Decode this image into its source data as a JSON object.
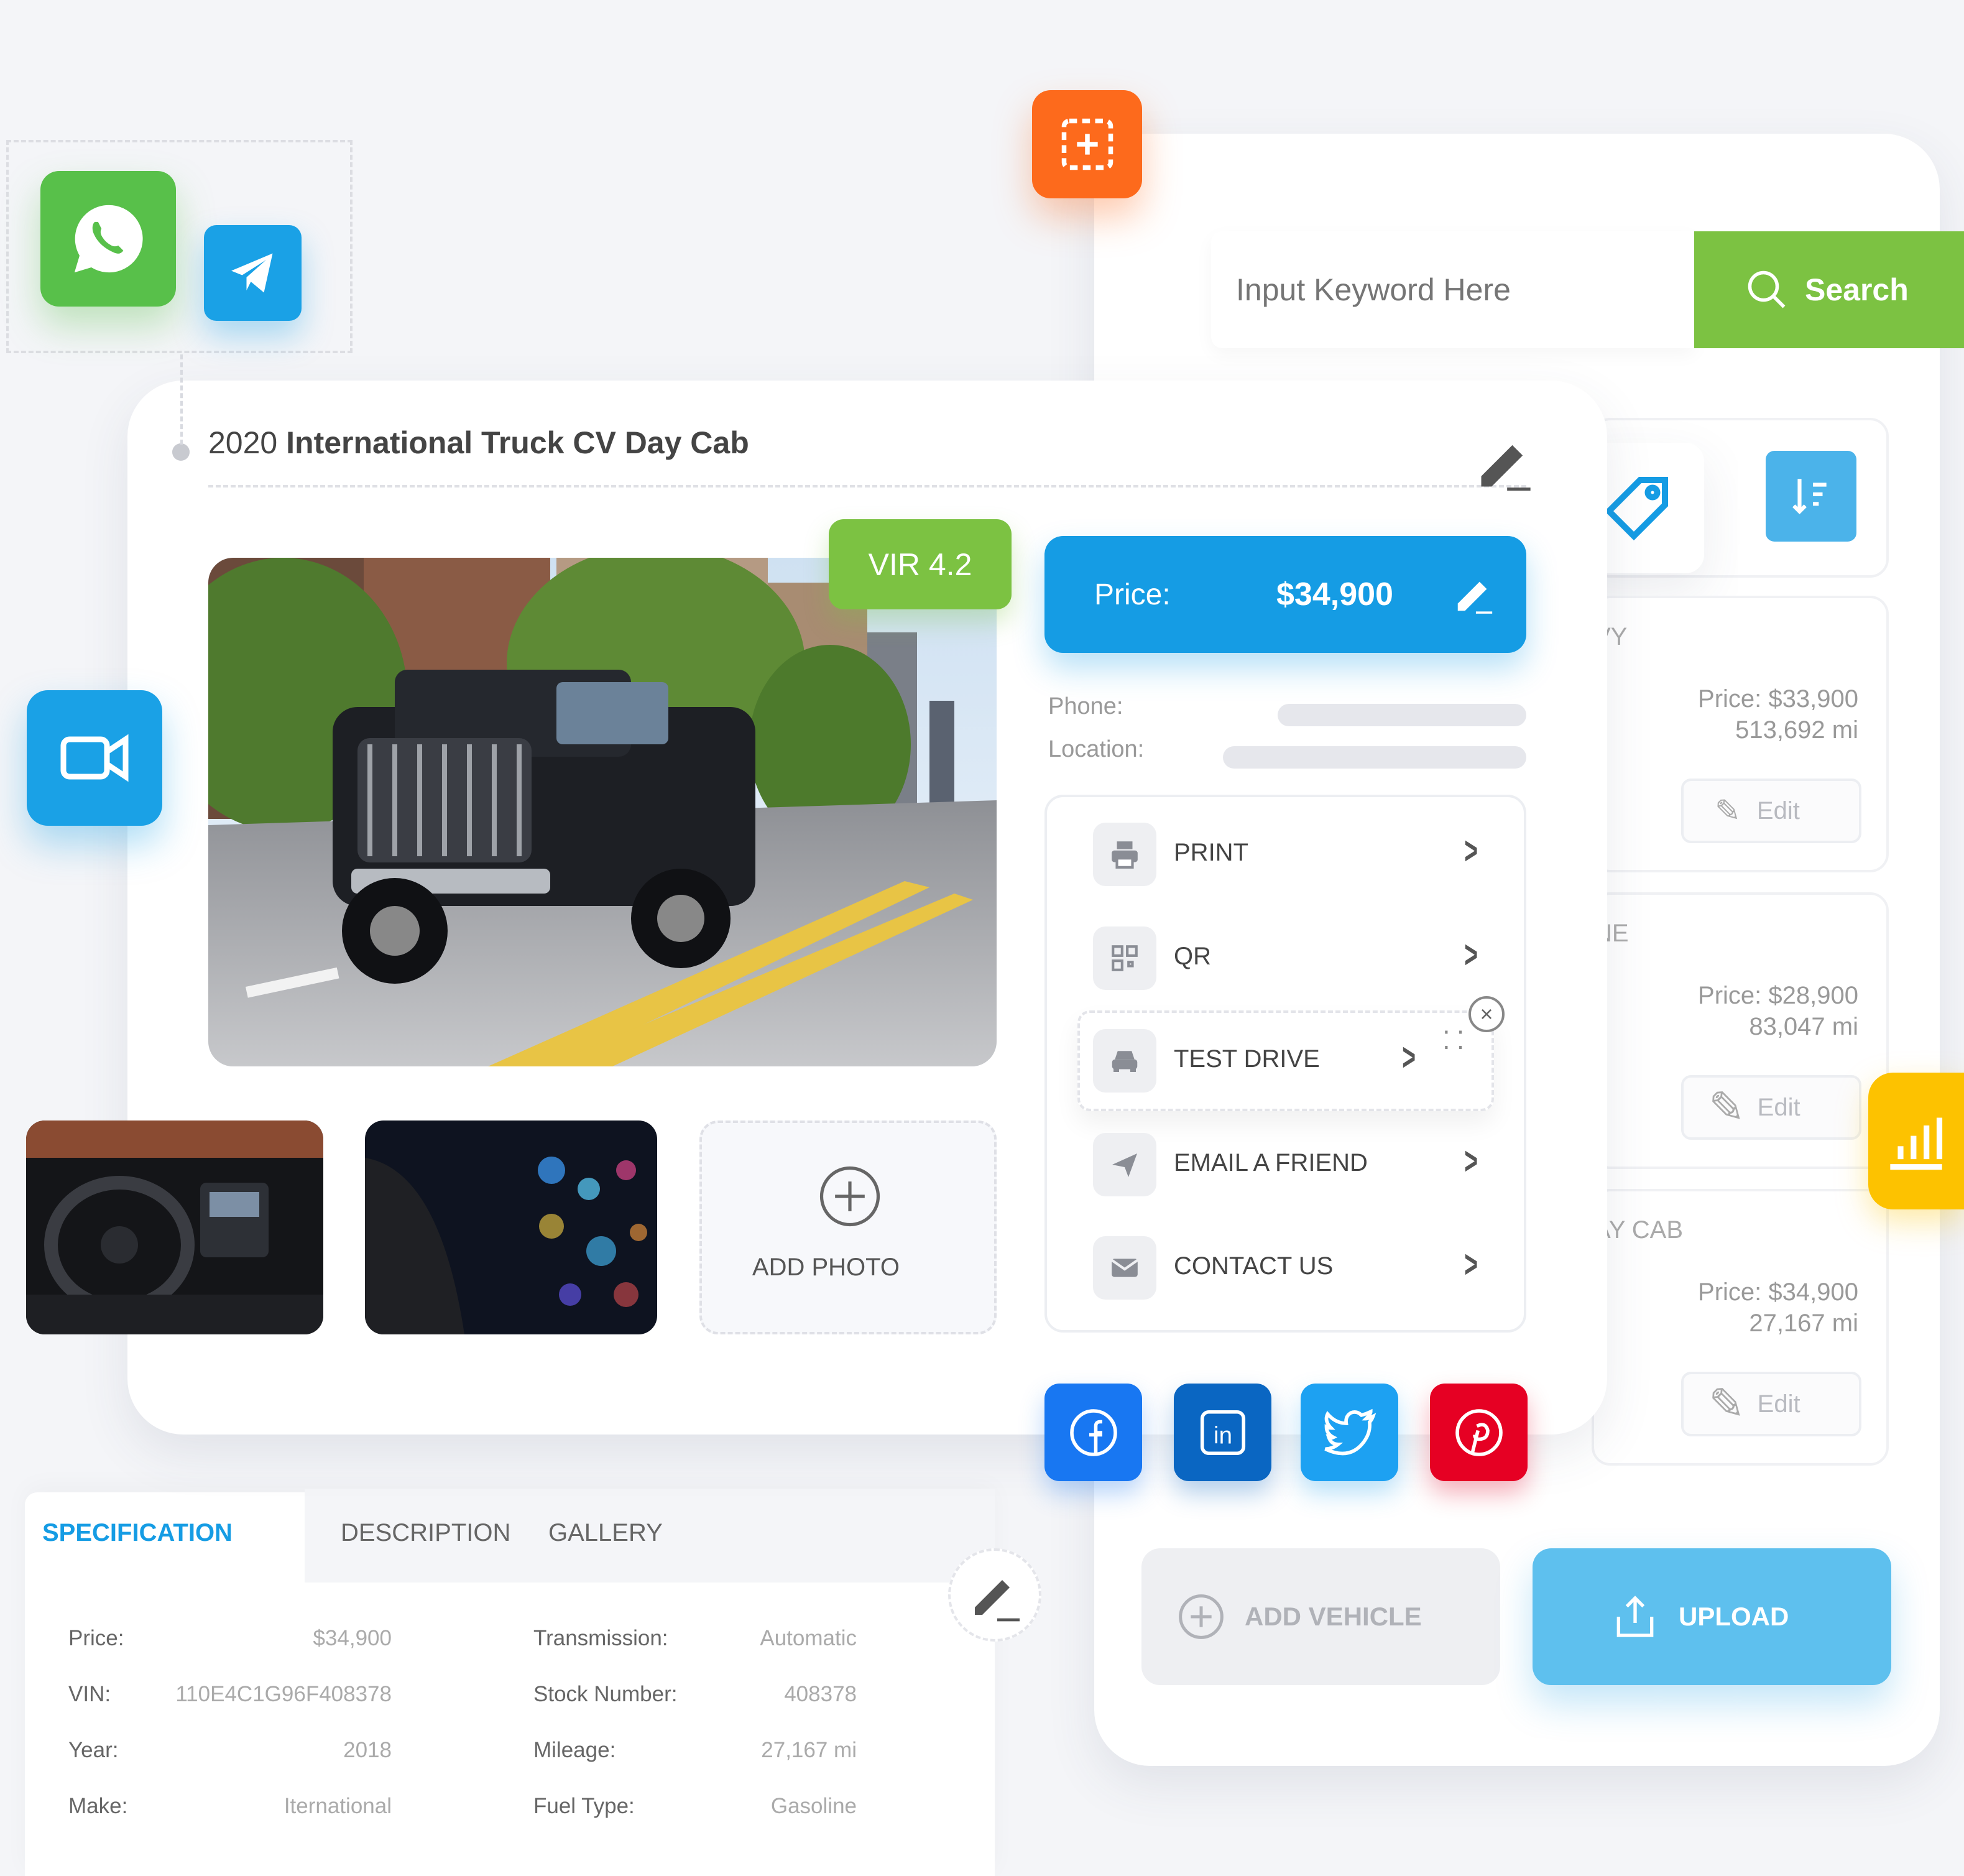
{
  "colors": {
    "green": "#7cc242",
    "blue": "#159ce4",
    "orange": "#fd6a1c",
    "yellow": "#fdc200",
    "facebook": "#1877f2",
    "linkedin": "#0a66c2",
    "twitter": "#1da1f2",
    "pinterest": "#e60023"
  },
  "search": {
    "placeholder": "Input Keyword Here",
    "button": "Search"
  },
  "listing": {
    "year": "2020",
    "name": "International Truck CV Day Cab",
    "vir": "VIR 4.2",
    "price_label": "Price:",
    "price_value": "$34,900",
    "phone_label": "Phone:",
    "location_label": "Location:"
  },
  "gallery": {
    "add_photo": "ADD PHOTO"
  },
  "actions": [
    {
      "label": "PRINT",
      "icon": "printer-icon"
    },
    {
      "label": "QR",
      "icon": "qr-code-icon"
    },
    {
      "label": "TEST DRIVE",
      "icon": "car-icon"
    },
    {
      "label": "EMAIL A FRIEND",
      "icon": "send-icon"
    },
    {
      "label": "CONTACT US",
      "icon": "envelope-icon"
    }
  ],
  "social": [
    "facebook-icon",
    "linkedin-icon",
    "twitter-icon",
    "pinterest-icon"
  ],
  "list_items": [
    {
      "title_fragment": "VY",
      "price_label": "Price:",
      "price": "$33,900",
      "mileage": "513,692 mi",
      "edit": "Edit"
    },
    {
      "title_fragment": "NE",
      "price_label": "Price:",
      "price": "$28,900",
      "mileage": "83,047 mi",
      "edit": "Edit"
    },
    {
      "title_fragment": "AY CAB",
      "price_label": "Price:",
      "price": "$34,900",
      "mileage": "27,167 mi",
      "edit": "Edit"
    }
  ],
  "bottom": {
    "add_vehicle": "ADD VEHICLE",
    "upload": "UPLOAD"
  },
  "tabs": [
    "SPECIFICATION",
    "DESCRIPTION",
    "GALLERY"
  ],
  "specs": {
    "left": [
      {
        "label": "Price:",
        "value": "$34,900"
      },
      {
        "label": "VIN:",
        "value": "110E4C1G96F408378"
      },
      {
        "label": "Year:",
        "value": "2018"
      },
      {
        "label": "Make:",
        "value": "Iternational"
      }
    ],
    "right": [
      {
        "label": "Transmission:",
        "value": "Automatic"
      },
      {
        "label": "Stock Number:",
        "value": "408378"
      },
      {
        "label": "Mileage:",
        "value": "27,167 mi"
      },
      {
        "label": "Fuel Type:",
        "value": "Gasoline"
      }
    ]
  }
}
